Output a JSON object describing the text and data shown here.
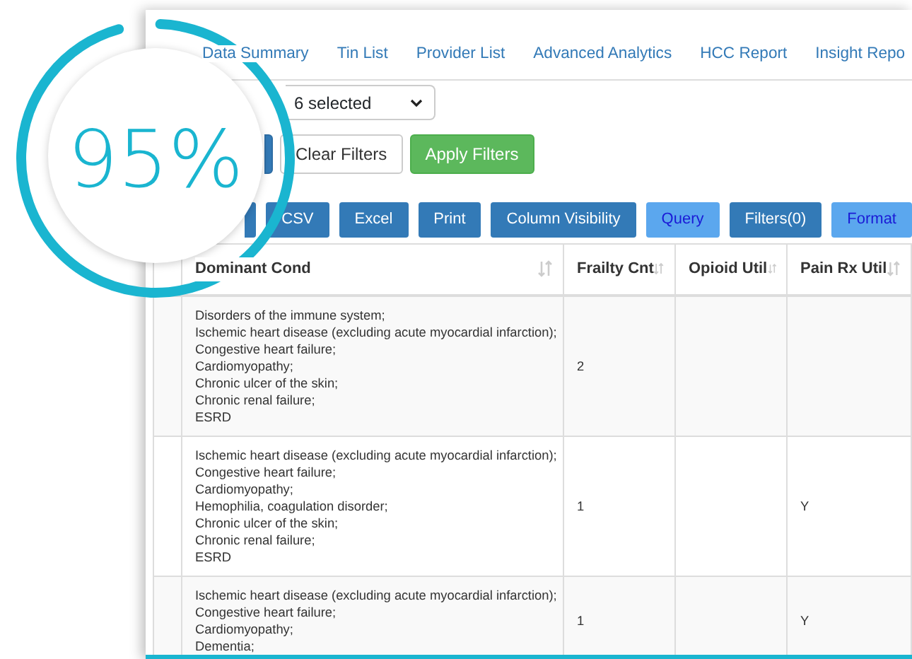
{
  "tabs": [
    {
      "label": "Data Summary",
      "selected": false
    },
    {
      "label": "Tin List",
      "selected": false
    },
    {
      "label": "Provider List",
      "selected": false
    },
    {
      "label": "Advanced Analytics",
      "selected": false
    },
    {
      "label": "HCC Report",
      "selected": false
    },
    {
      "label": "Insight Repo",
      "selected": false
    }
  ],
  "select": {
    "value": "6 selected"
  },
  "filter_buttons": [
    {
      "kind": "primary"
    },
    {
      "label": "Clear Filters",
      "kind": "outline"
    },
    {
      "label": "Apply Filters",
      "kind": "success"
    }
  ],
  "export_buttons": [
    {
      "kind": "dark"
    },
    {
      "label": "CSV",
      "kind": "dark"
    },
    {
      "label": "Excel",
      "kind": "dark"
    },
    {
      "label": "Print",
      "kind": "dark"
    },
    {
      "label": "Column Visibility",
      "kind": "dark"
    },
    {
      "label": "Query",
      "kind": "light"
    },
    {
      "label": "Filters(0)",
      "kind": "dark"
    },
    {
      "label": "Format",
      "kind": "light"
    }
  ],
  "table": {
    "columns": [
      "Dominant Cond",
      "Frailty Cnt",
      "Opioid Util",
      "Pain Rx Util"
    ],
    "rows": [
      [
        "Disorders of the immune system;\nIschemic heart disease (excluding acute myocardial infarction);\nCongestive heart failure;\nCardiomyopathy;\nChronic ulcer of the skin;\nChronic renal failure;\nESRD",
        "2",
        "",
        ""
      ],
      [
        "Ischemic heart disease (excluding acute myocardial infarction);\nCongestive heart failure;\nCardiomyopathy;\nHemophilia, coagulation disorder;\nChronic ulcer of the skin;\nChronic renal failure;\nESRD",
        "1",
        "",
        "Y"
      ],
      [
        "Ischemic heart disease (excluding acute myocardial infarction);\nCongestive heart failure;\nCardiomyopathy;\nDementia;",
        "1",
        "",
        "Y"
      ]
    ]
  },
  "ring": {
    "label": "95%",
    "level": 0.95
  }
}
